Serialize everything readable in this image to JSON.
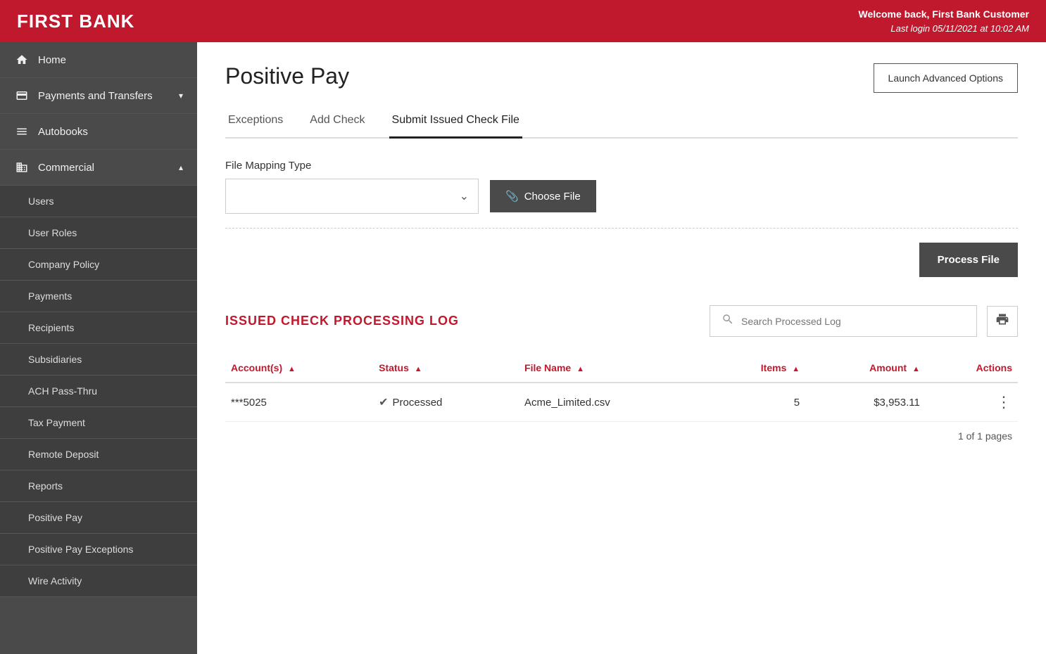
{
  "header": {
    "logo": "FIRST BANK",
    "welcome": "Welcome back, First Bank Customer",
    "last_login": "Last login 05/11/2021 at 10:02 AM"
  },
  "sidebar": {
    "items": [
      {
        "id": "home",
        "label": "Home",
        "icon": "home",
        "has_sub": false
      },
      {
        "id": "payments",
        "label": "Payments and Transfers",
        "icon": "credit-card",
        "has_sub": true,
        "expanded": true
      },
      {
        "id": "autobooks",
        "label": "Autobooks",
        "icon": "menu",
        "has_sub": false
      },
      {
        "id": "commercial",
        "label": "Commercial",
        "icon": "building",
        "has_sub": true,
        "expanded": true
      }
    ],
    "sub_items": [
      {
        "id": "users",
        "label": "Users"
      },
      {
        "id": "user-roles",
        "label": "User Roles"
      },
      {
        "id": "company-policy",
        "label": "Company Policy"
      },
      {
        "id": "payments",
        "label": "Payments"
      },
      {
        "id": "recipients",
        "label": "Recipients"
      },
      {
        "id": "subsidiaries",
        "label": "Subsidiaries"
      },
      {
        "id": "ach-pass-thru",
        "label": "ACH Pass-Thru"
      },
      {
        "id": "tax-payment",
        "label": "Tax Payment"
      },
      {
        "id": "remote-deposit",
        "label": "Remote Deposit"
      },
      {
        "id": "reports",
        "label": "Reports"
      },
      {
        "id": "positive-pay",
        "label": "Positive Pay"
      },
      {
        "id": "positive-pay-exceptions",
        "label": "Positive Pay Exceptions"
      },
      {
        "id": "wire-activity",
        "label": "Wire Activity"
      }
    ]
  },
  "page": {
    "title": "Positive Pay",
    "launch_btn": "Launch Advanced Options",
    "tabs": [
      {
        "id": "exceptions",
        "label": "Exceptions",
        "active": false
      },
      {
        "id": "add-check",
        "label": "Add Check",
        "active": false
      },
      {
        "id": "submit-issued",
        "label": "Submit Issued Check File",
        "active": true
      }
    ]
  },
  "file_section": {
    "label": "File Mapping Type",
    "dropdown_placeholder": "",
    "choose_file_btn": "Choose File",
    "process_file_btn": "Process File"
  },
  "log_section": {
    "title": "ISSUED CHECK PROCESSING LOG",
    "search_placeholder": "Search Processed Log",
    "columns": [
      {
        "id": "accounts",
        "label": "Account(s)",
        "sortable": true
      },
      {
        "id": "status",
        "label": "Status",
        "sortable": true
      },
      {
        "id": "file_name",
        "label": "File Name",
        "sortable": true
      },
      {
        "id": "items",
        "label": "Items",
        "sortable": true
      },
      {
        "id": "amount",
        "label": "Amount",
        "sortable": true
      },
      {
        "id": "actions",
        "label": "Actions",
        "sortable": false
      }
    ],
    "rows": [
      {
        "account": "***5025",
        "status": "Processed",
        "file_name": "Acme_Limited.csv",
        "items": "5",
        "amount": "$3,953.11"
      }
    ],
    "pagination": "1 of 1 pages"
  }
}
